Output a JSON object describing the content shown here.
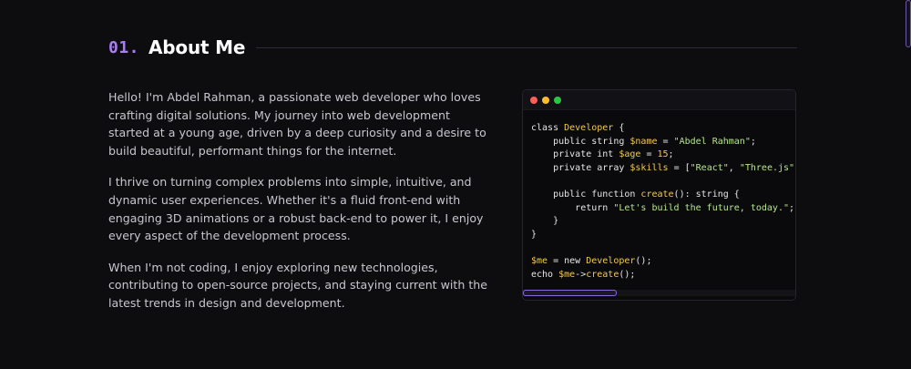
{
  "section": {
    "number": "01.",
    "title": "About Me"
  },
  "bio": {
    "paragraphs": [
      "Hello! I'm Abdel Rahman, a passionate web developer who loves crafting digital solutions. My journey into web development started at a young age, driven by a deep curiosity and a desire to build beautiful, performant things for the internet.",
      "I thrive on turning complex problems into simple, intuitive, and dynamic user experiences. Whether it's a fluid front-end with engaging 3D animations or a robust back-end to power it, I enjoy every aspect of the development process.",
      "When I'm not coding, I enjoy exploring new technologies, contributing to open-source projects, and staying current with the latest trends in design and development."
    ]
  },
  "code_window": {
    "line1": {
      "kw": "class ",
      "cls": "Developer",
      "rest": " {"
    },
    "line2": {
      "indent": "    ",
      "kw": "public string ",
      "var": "$name",
      "op": " = ",
      "str": "\"Abdel Rahman\"",
      "end": ";"
    },
    "line3": {
      "indent": "    ",
      "kw": "private int ",
      "var": "$age",
      "op": " = ",
      "num": "15",
      "end": ";"
    },
    "line4": {
      "indent": "    ",
      "kw": "private array ",
      "var": "$skills",
      "op": " = [",
      "str1": "\"React\"",
      "sep": ", ",
      "str2": "\"Three.js\"",
      "end": ", "
    },
    "line5": {
      "indent": "    ",
      "kw": "public function ",
      "fn": "create",
      "rest": "(): string {"
    },
    "line6": {
      "indent": "        ",
      "kw": "return ",
      "str": "\"Let's build the future, today.\"",
      "end": ";"
    },
    "line7": {
      "text": "    }"
    },
    "line8": {
      "text": "}"
    },
    "line9": {
      "var": "$me",
      "op": " = new ",
      "cls": "Developer",
      "end": "();"
    },
    "line10": {
      "kw": "echo ",
      "var": "$me",
      "op": "->",
      "fn": "create",
      "end": "();"
    }
  },
  "colors": {
    "accent": "#a77ff0",
    "background": "#0d0c0f",
    "code_highlight": "#f2c94c",
    "code_string": "#b7e68a"
  }
}
